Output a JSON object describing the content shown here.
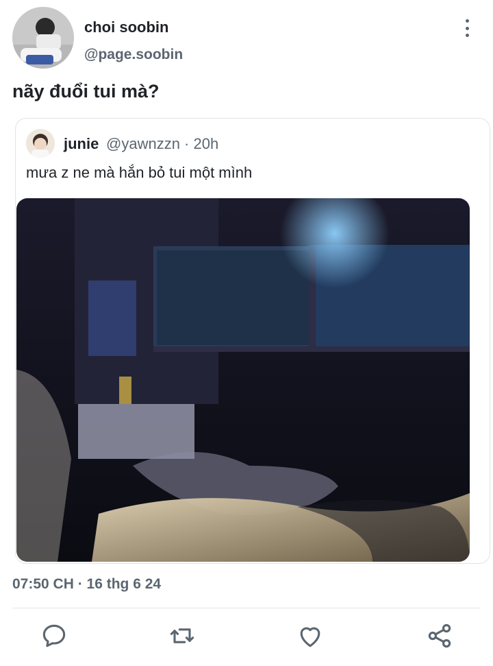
{
  "post": {
    "display_name": "choi soobin",
    "handle": "@page.soobin",
    "text": "nãy đuổi tui mà?",
    "timestamp": "07:50 CH · 16 thg 6 24"
  },
  "quoted": {
    "name": "junie",
    "meta": "@yawnzzn · 20h",
    "text": "mưa z ne mà hắn bỏ tui một mình"
  },
  "icons": {
    "more": "more-vertical-icon",
    "reply": "reply-icon",
    "retweet": "retweet-icon",
    "like": "heart-icon",
    "share": "share-icon"
  },
  "colors": {
    "text": "#1f2328",
    "secondary": "#5b6670",
    "border": "#dfe3e7"
  }
}
